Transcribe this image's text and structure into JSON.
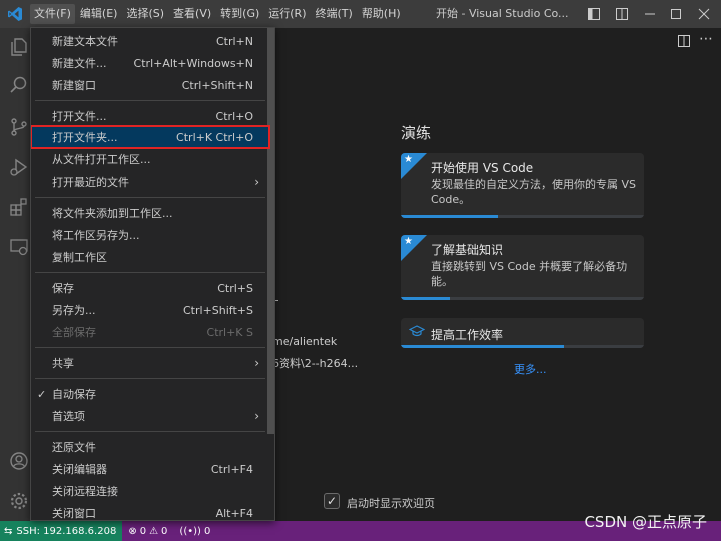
{
  "menubar": {
    "items": [
      "文件(F)",
      "编辑(E)",
      "选择(S)",
      "查看(V)",
      "转到(G)",
      "运行(R)",
      "终端(T)",
      "帮助(H)"
    ],
    "window_title": "开始 - Visual Studio Co..."
  },
  "file_menu": {
    "items": [
      {
        "label": "新建文本文件",
        "shortcut": "Ctrl+N"
      },
      {
        "label": "新建文件...",
        "shortcut": "Ctrl+Alt+Windows+N"
      },
      {
        "label": "新建窗口",
        "shortcut": "Ctrl+Shift+N"
      },
      {
        "label": "打开文件...",
        "shortcut": "Ctrl+O"
      },
      {
        "label": "打开文件夹...",
        "shortcut": "Ctrl+K Ctrl+O"
      },
      {
        "label": "从文件打开工作区...",
        "shortcut": ""
      },
      {
        "label": "打开最近的文件",
        "shortcut": ""
      },
      {
        "label": "将文件夹添加到工作区...",
        "shortcut": ""
      },
      {
        "label": "将工作区另存为...",
        "shortcut": ""
      },
      {
        "label": "复制工作区",
        "shortcut": ""
      },
      {
        "label": "保存",
        "shortcut": "Ctrl+S"
      },
      {
        "label": "另存为...",
        "shortcut": "Ctrl+Shift+S"
      },
      {
        "label": "全部保存",
        "shortcut": "Ctrl+K S"
      },
      {
        "label": "共享",
        "shortcut": ""
      },
      {
        "label": "自动保存",
        "shortcut": ""
      },
      {
        "label": "首选项",
        "shortcut": ""
      },
      {
        "label": "还原文件",
        "shortcut": ""
      },
      {
        "label": "关闭编辑器",
        "shortcut": "Ctrl+F4"
      },
      {
        "label": "关闭远程连接",
        "shortcut": ""
      },
      {
        "label": "关闭窗口",
        "shortcut": "Alt+F4"
      }
    ]
  },
  "welcome": {
    "walkthroughs_title": "演练",
    "cards": [
      {
        "title": "开始使用 VS Code",
        "description": "发现最佳的自定义方法，使用你的专属 VS Code。",
        "progress": 0.4
      },
      {
        "title": "了解基础知识",
        "description": "直接跳转到 VS Code 并概要了解必备功能。",
        "progress": 0.2
      },
      {
        "title": "提高工作效率",
        "progress": 0.67
      }
    ],
    "more_link": "更多...",
    "recent": [
      "me/alientek",
      "6资料\\2--h264..."
    ],
    "show_on_startup": "启动时显示欢迎页",
    "show_on_startup_checked": true
  },
  "statusbar": {
    "remote": "SSH: 192.168.6.208",
    "errors": "0",
    "warnings": "0",
    "ports": "0"
  },
  "watermark": "CSDN @正点原子",
  "colors": {
    "accent": "#2a8ad4",
    "statusbar": "#68217a",
    "remote": "#16825d",
    "highlight_border": "#e02424"
  }
}
